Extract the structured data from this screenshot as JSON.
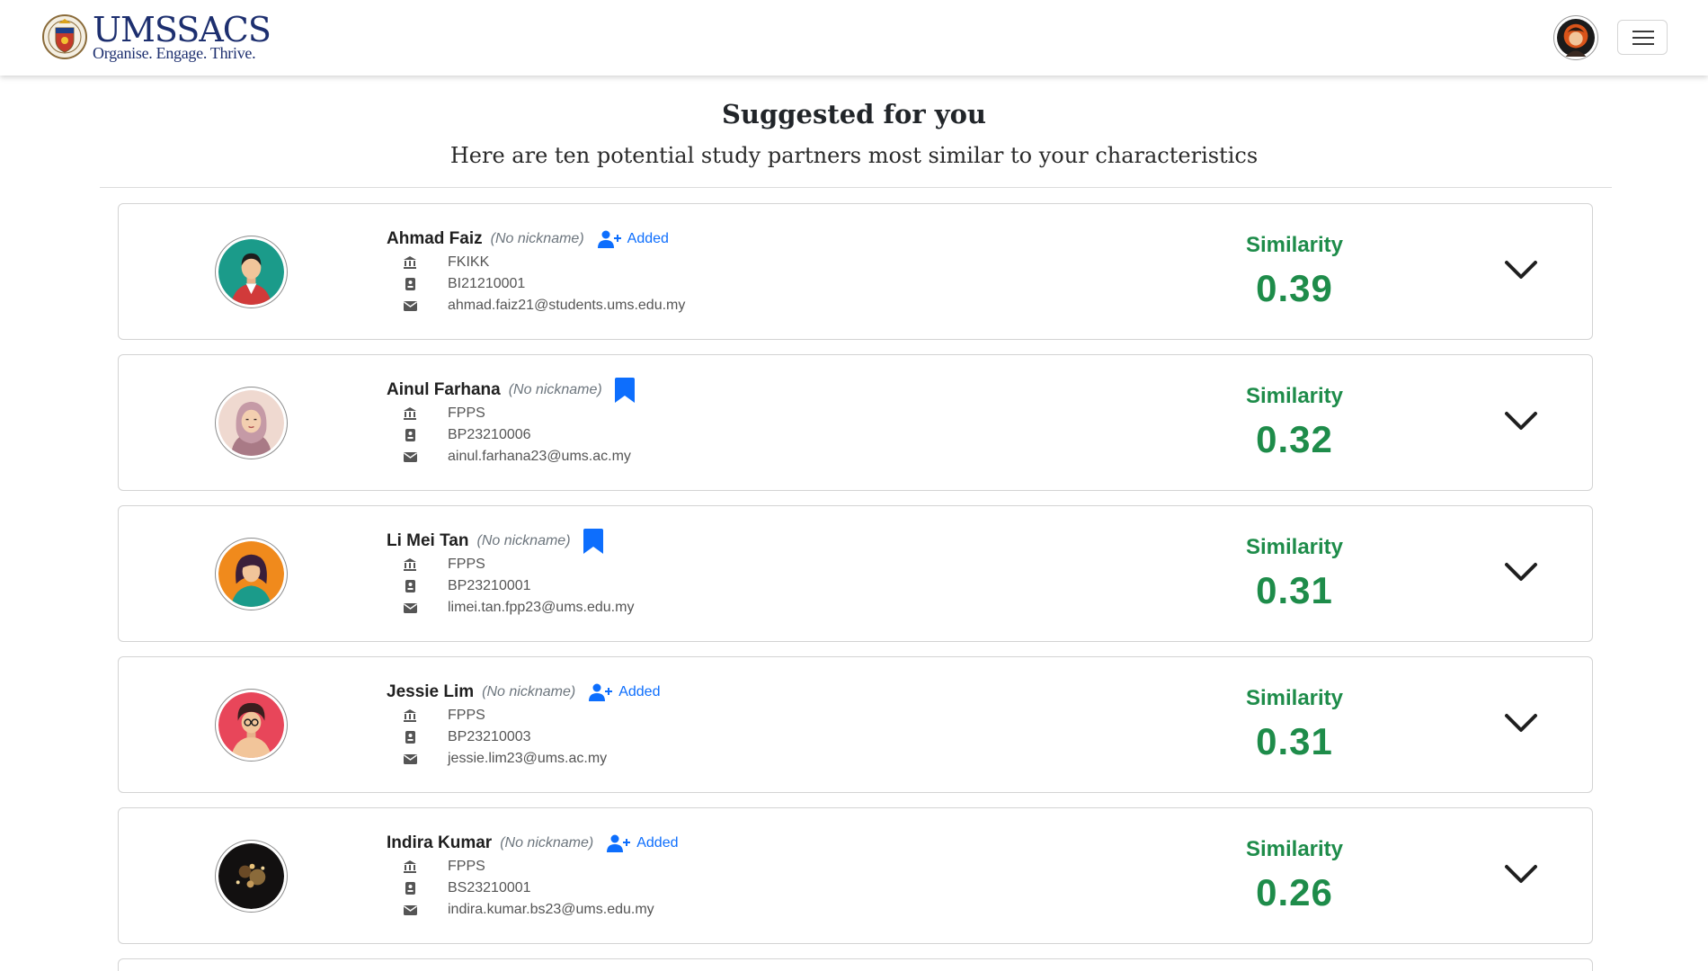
{
  "brand": {
    "name": "UMSSACS",
    "tagline": "Organise. Engage. Thrive."
  },
  "header": {
    "title": "Suggested for you",
    "subtitle": "Here are ten potential study partners most similar to your characteristics"
  },
  "colors": {
    "accent_green": "#1e8c4a",
    "link_blue": "#0d6efd",
    "brand_navy": "#1d2f6f"
  },
  "cards": [
    {
      "name": "Ahmad Faiz",
      "nickname": "(No nickname)",
      "action": "added",
      "action_label": "Added",
      "faculty": "FKIKK",
      "matric": "BI21210001",
      "email": "ahmad.faiz21@students.ums.edu.my",
      "similarity_label": "Similarity",
      "similarity": "0.39",
      "avatar": "male-avatar-teal"
    },
    {
      "name": "Ainul Farhana",
      "nickname": "(No nickname)",
      "action": "bookmark",
      "action_label": "",
      "faculty": "FPPS",
      "matric": "BP23210006",
      "email": "ainul.farhana23@ums.ac.my",
      "similarity_label": "Similarity",
      "similarity": "0.32",
      "avatar": "hijab-avatar"
    },
    {
      "name": "Li Mei Tan",
      "nickname": "(No nickname)",
      "action": "bookmark",
      "action_label": "",
      "faculty": "FPPS",
      "matric": "BP23210001",
      "email": "limei.tan.fpp23@ums.edu.my",
      "similarity_label": "Similarity",
      "similarity": "0.31",
      "avatar": "female-avatar-orange"
    },
    {
      "name": "Jessie Lim",
      "nickname": "(No nickname)",
      "action": "added",
      "action_label": "Added",
      "faculty": "FPPS",
      "matric": "BP23210003",
      "email": "jessie.lim23@ums.ac.my",
      "similarity_label": "Similarity",
      "similarity": "0.31",
      "avatar": "curly-hair-avatar-pink"
    },
    {
      "name": "Indira Kumar",
      "nickname": "(No nickname)",
      "action": "added",
      "action_label": "Added",
      "faculty": "FPPS",
      "matric": "BS23210001",
      "email": "indira.kumar.bs23@ums.edu.my",
      "similarity_label": "Similarity",
      "similarity": "0.26",
      "avatar": "photo-avatar"
    }
  ]
}
